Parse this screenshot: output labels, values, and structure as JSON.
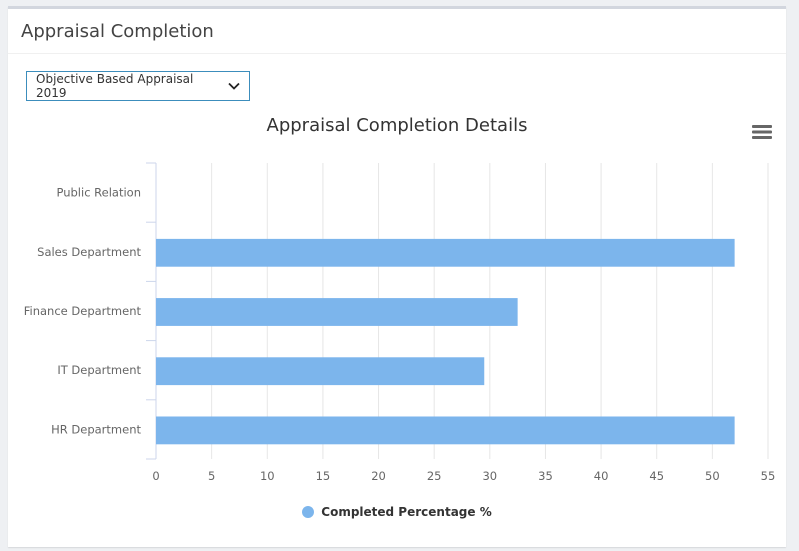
{
  "panel": {
    "title": "Appraisal Completion"
  },
  "filter": {
    "selected": "Objective Based Appraisal 2019"
  },
  "colors": {
    "bar": "#7cb5ec",
    "grid": "#e6e6e6",
    "axis": "#ccd6eb",
    "text": "#666666"
  },
  "chart_data": {
    "type": "bar",
    "orientation": "horizontal",
    "title": "Appraisal Completion Details",
    "categories": [
      "Public Relation",
      "Sales Department",
      "Finance Department",
      "IT Department",
      "HR Department"
    ],
    "series": [
      {
        "name": "Completed Percentage %",
        "values": [
          0,
          52,
          32.5,
          29.5,
          52
        ]
      }
    ],
    "xlim": [
      0,
      55
    ],
    "ticks": [
      0,
      5,
      10,
      15,
      20,
      25,
      30,
      35,
      40,
      45,
      50,
      55
    ],
    "grid": true,
    "legend": "bottom-center"
  }
}
